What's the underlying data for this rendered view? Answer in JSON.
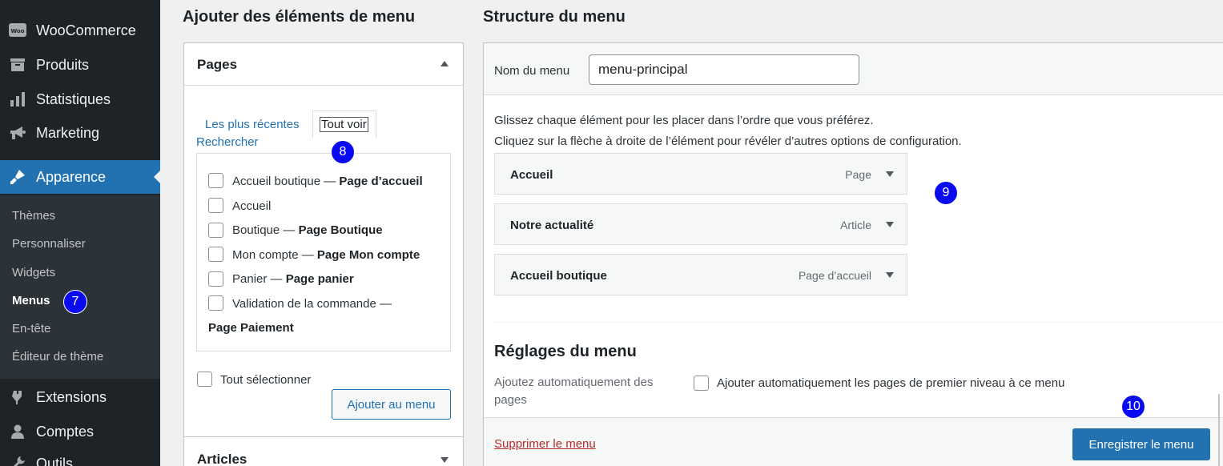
{
  "sidebar": {
    "items": [
      {
        "label": "WooCommerce",
        "icon": "woo-icon"
      },
      {
        "label": "Produits",
        "icon": "archive-icon"
      },
      {
        "label": "Statistiques",
        "icon": "bar-chart-icon"
      },
      {
        "label": "Marketing",
        "icon": "megaphone-icon"
      },
      {
        "label": "Apparence",
        "icon": "paintbrush-icon",
        "active": true
      },
      {
        "label": "Extensions",
        "icon": "plugin-icon"
      },
      {
        "label": "Comptes",
        "icon": "user-icon"
      },
      {
        "label": "Outils",
        "icon": "wrench-icon"
      }
    ],
    "submenu": [
      "Thèmes",
      "Personnaliser",
      "Widgets",
      "Menus",
      "En-tête",
      "Éditeur de thème"
    ],
    "current_sub": "Menus",
    "woo_logo_text": "Woo"
  },
  "badges": [
    "7",
    "8",
    "9",
    "10"
  ],
  "left": {
    "title": "Ajouter des éléments de menu",
    "pages_box": {
      "title": "Pages",
      "tabs": [
        "Les plus récentes",
        "Tout voir",
        "Rechercher"
      ],
      "items": [
        {
          "label": "Accueil boutique — ",
          "bold": "Page d’accueil"
        },
        {
          "label": "Accueil",
          "bold": ""
        },
        {
          "label": "Boutique — ",
          "bold": "Page Boutique"
        },
        {
          "label": "Mon compte — ",
          "bold": "Page Mon compte"
        },
        {
          "label": "Panier — ",
          "bold": "Page panier"
        },
        {
          "label": "Validation de la commande —",
          "bold": ""
        }
      ],
      "wrapped_bold": "Page Paiement",
      "select_all": "Tout sélectionner",
      "add_button": "Ajouter au menu"
    },
    "articles_box": {
      "title": "Articles"
    }
  },
  "right": {
    "title": "Structure du menu",
    "name_label": "Nom du menu",
    "name_value": "menu-principal",
    "instructions": [
      "Glissez chaque élément pour les placer dans l’ordre que vous préférez.",
      "Cliquez sur la flèche à droite de l’élément pour révéler d’autres options de configuration."
    ],
    "menu_items": [
      {
        "title": "Accueil",
        "type": "Page"
      },
      {
        "title": "Notre actualité",
        "type": "Article"
      },
      {
        "title": "Accueil boutique",
        "type": "Page d’accueil"
      }
    ],
    "settings_title": "Réglages du menu",
    "settings_label": "Ajoutez automatiquement des pages",
    "auto_add_label": "Ajouter automatiquement les pages de premier niveau à ce menu",
    "delete_link": "Supprimer le menu",
    "save_button": "Enregistrer le menu"
  },
  "colors": {
    "sidebar_bg": "#1d2327",
    "accent": "#2271b1",
    "badge": "#0a0af0",
    "delete": "#b32d2e"
  }
}
